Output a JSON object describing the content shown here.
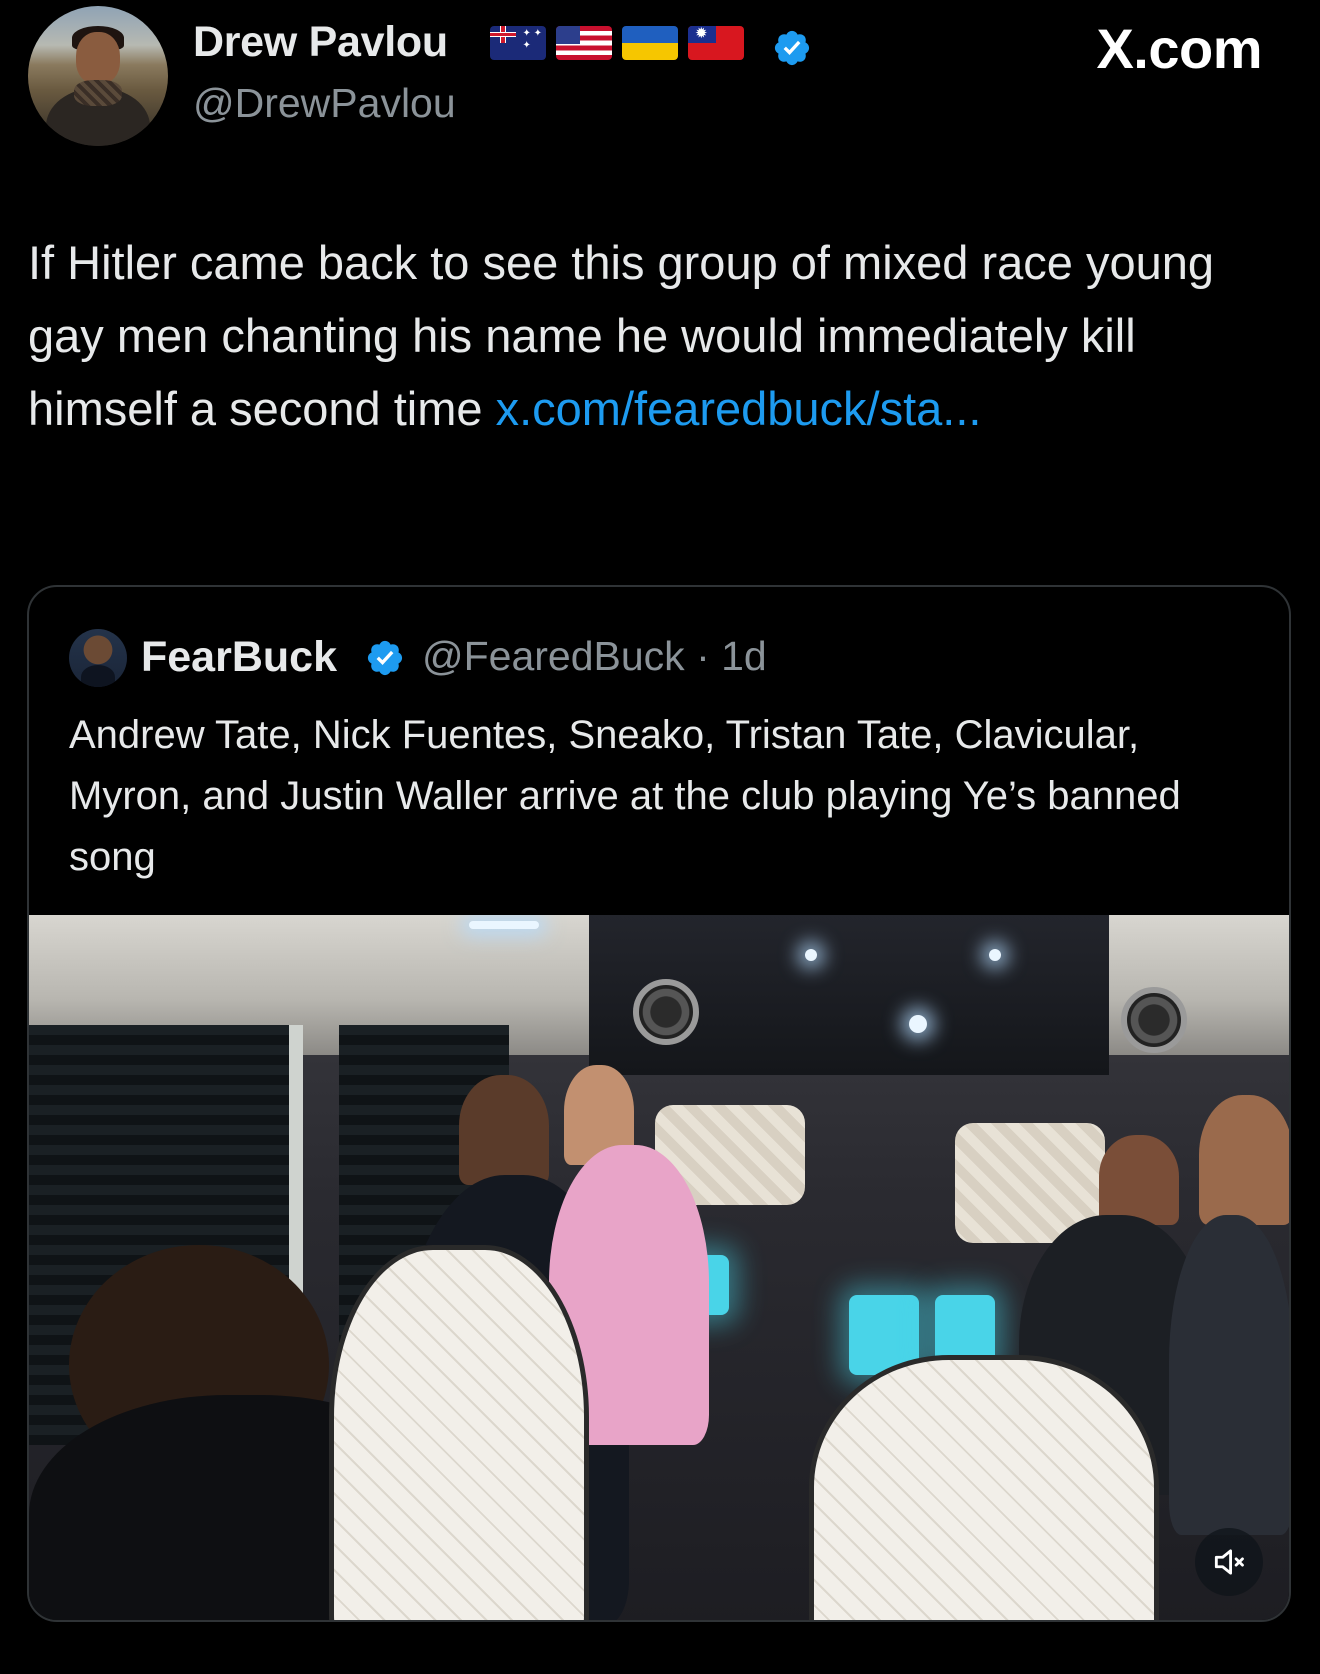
{
  "author": {
    "name": "Drew Pavlou",
    "handle": "@DrewPavlou",
    "flags": [
      "australia-flag-icon",
      "usa-flag-icon",
      "ukraine-flag-icon",
      "taiwan-flag-icon"
    ],
    "verified": true
  },
  "site_label": "X.com",
  "tweet": {
    "text": "If Hitler came back to see this group of mixed race young gay men chanting his name he would immediately kill himself a second time ",
    "link": "x.com/​fearedbuck/sta..."
  },
  "quoted_tweet": {
    "name": "FearBuck",
    "handle_and_time": "@FearedBuck · 1d",
    "verified": true,
    "text": "Andrew Tate, Nick Fuentes, Sneako, Tristan Tate, Clavicular, Myron, and Justin Waller arrive at the club playing Ye’s banned song",
    "media": {
      "type": "video",
      "muted": true
    }
  },
  "colors": {
    "background": "#000000",
    "text": "#e7e9ea",
    "secondary_text": "#8b9399",
    "link": "#1d9bf0",
    "verified": "#1d9bf0",
    "card_border": "#2f3336"
  }
}
